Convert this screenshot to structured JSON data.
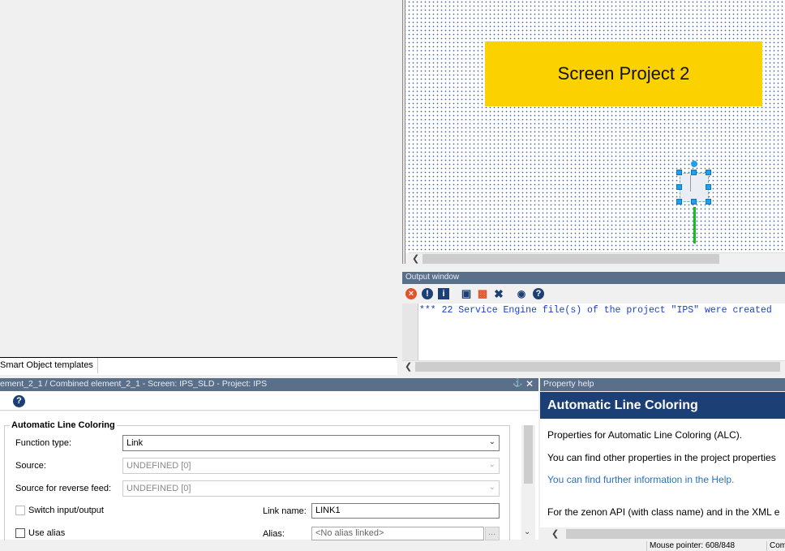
{
  "left_panel": {
    "tab_label": "Smart Object templates"
  },
  "canvas": {
    "title_text": "Screen  Project 2",
    "title_color": "#fbd100",
    "selection_color": "#1fa0ec",
    "line_color": "#15c01a"
  },
  "output_window": {
    "title": "Output window",
    "toolbar_icons": [
      "error-icon",
      "warning-icon",
      "info-icon",
      "save-icon",
      "copy-icon",
      "clear-icon",
      "find-icon",
      "help-icon"
    ],
    "message": "*** 22 Service Engine file(s) of the project \"IPS\" were created"
  },
  "properties": {
    "header": "ement_2_1 / Combined element_2_1 - Screen: IPS_SLD - Project: IPS",
    "group_title": "Automatic Line Coloring",
    "function_type": {
      "label": "Function type:",
      "value": "Link"
    },
    "source": {
      "label": "Source:",
      "value": "UNDEFINED [0]"
    },
    "reverse_source": {
      "label": "Source for reverse feed:",
      "value": "UNDEFINED [0]"
    },
    "switch_io": {
      "label": "Switch input/output"
    },
    "link_name": {
      "label": "Link name:",
      "value": "LINK1"
    },
    "use_alias": {
      "label": "Use alias"
    },
    "alias": {
      "label": "Alias:",
      "placeholder": "<No alias linked>",
      "browse": "..."
    }
  },
  "property_help": {
    "title": "Property help",
    "heading": "Automatic Line Coloring",
    "p1": "Properties for Automatic Line Coloring (ALC).",
    "p2": "You can find other properties in the project properties",
    "link": "You can find further information in the Help.",
    "p3": "For the zenon API (with class name) and in the XML e"
  },
  "status_bar": {
    "mouse": "Mouse pointer: 608/848",
    "extra": "Com"
  }
}
